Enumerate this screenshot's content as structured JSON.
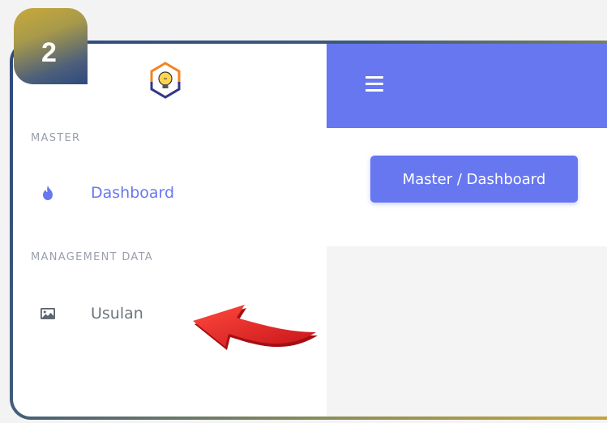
{
  "step": {
    "number": "2"
  },
  "sidebar": {
    "logo_icon": "lightbulb-logo-icon",
    "sections": [
      {
        "label": "MASTER"
      },
      {
        "label": "MANAGEMENT DATA"
      }
    ],
    "items": [
      {
        "label": "Dashboard",
        "icon": "fire-icon",
        "active": true
      },
      {
        "label": "Usulan",
        "icon": "image-icon",
        "active": false
      }
    ]
  },
  "topbar": {
    "menu_icon": "hamburger-menu-icon"
  },
  "header": {
    "breadcrumb": "Master / Dashboard"
  },
  "annotation": {
    "icon": "red-curved-arrow-icon"
  },
  "colors": {
    "primary": "#6777ef",
    "sidebar_bg": "#ffffff",
    "muted_text": "#9aa0ac",
    "arrow_red": "#e4221f",
    "badge_gold": "#c9a93c",
    "badge_navy": "#2d4a7f"
  }
}
